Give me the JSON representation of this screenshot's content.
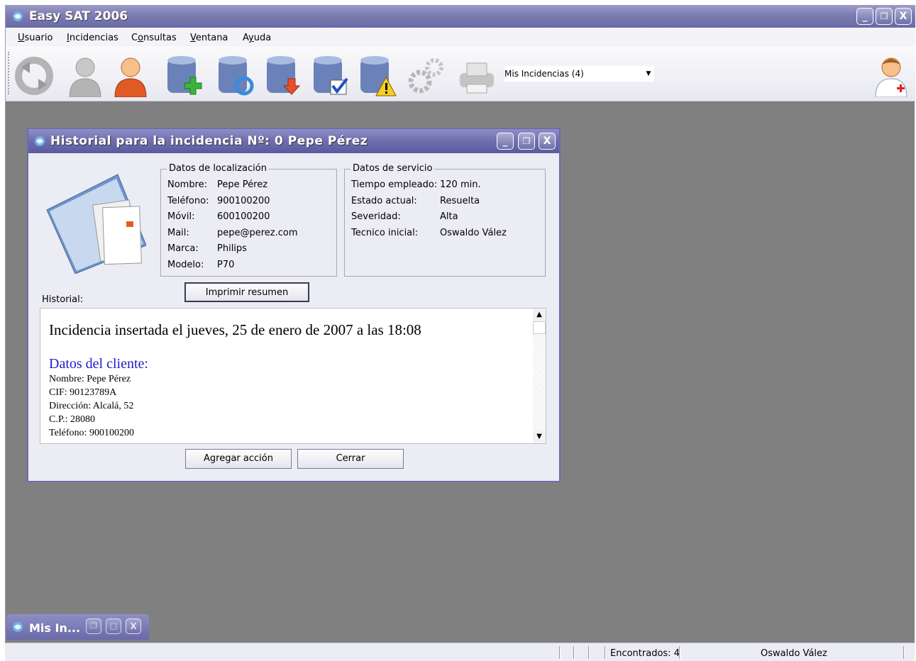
{
  "app": {
    "title": "Easy SAT 2006",
    "window_buttons": {
      "minimize": "_",
      "restore": "❐",
      "close": "X"
    }
  },
  "menu": [
    {
      "label": "Usuario",
      "key": "U"
    },
    {
      "label": "Incidencias",
      "key": "I"
    },
    {
      "label": "Consultas",
      "key": "o"
    },
    {
      "label": "Ventana",
      "key": "V"
    },
    {
      "label": "Ayuda",
      "key": "y"
    }
  ],
  "toolbar": {
    "icons": [
      "refresh-icon",
      "user-gray-icon",
      "user-orange-icon",
      "db-add-icon",
      "db-sync-icon",
      "db-download-icon",
      "db-check-icon",
      "db-warning-icon",
      "gears-icon",
      "printer-icon",
      "doctor-icon"
    ],
    "filter_value": "Mis Incidencias (4)"
  },
  "child": {
    "title": "Historial para la incidencia Nº: 0 Pepe Pérez",
    "localizacion": {
      "legend": "Datos de localización",
      "rows": [
        {
          "label": "Nombre:",
          "value": "Pepe Pérez"
        },
        {
          "label": "Teléfono:",
          "value": "900100200"
        },
        {
          "label": "Móvil:",
          "value": "600100200"
        },
        {
          "label": "Mail:",
          "value": "pepe@perez.com"
        },
        {
          "label": "Marca:",
          "value": "Philips"
        },
        {
          "label": "Modelo:",
          "value": "P70"
        }
      ]
    },
    "servicio": {
      "legend": "Datos de servicio",
      "rows": [
        {
          "label": "Tiempo empleado:",
          "value": "120 min."
        },
        {
          "label": "Estado actual:",
          "value": "Resuelta"
        },
        {
          "label": "Severidad:",
          "value": "Alta"
        },
        {
          "label": "Tecnico inicial:",
          "value": "Oswaldo Vález"
        }
      ]
    },
    "print_button": "Imprimir resumen",
    "historial_label": "Historial:",
    "historial": {
      "heading": "Incidencia insertada el jueves, 25 de enero de 2007 a las 18:08",
      "subheading": "Datos del cliente:",
      "lines": [
        "Nombre: Pepe Pérez",
        "CIF: 90123789A",
        "Dirección: Alcalá, 52",
        "C.P.: 28080",
        "Teléfono: 900100200"
      ]
    },
    "add_action_button": "Agregar acción",
    "close_button": "Cerrar"
  },
  "minimized_window": {
    "title": "Mis In..."
  },
  "status": {
    "found": "Encontrados: 4",
    "user": "Oswaldo Vález"
  }
}
